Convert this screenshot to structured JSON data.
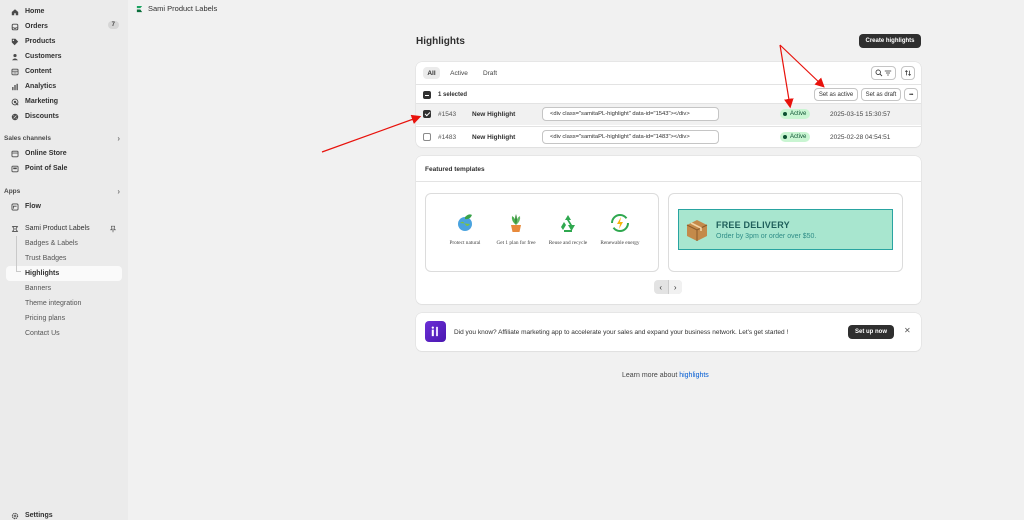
{
  "app_title": "Sami Product Labels",
  "sidebar": {
    "main_items": [
      {
        "label": "Home",
        "icon": "home-icon"
      },
      {
        "label": "Orders",
        "icon": "orders-icon",
        "badge": "7"
      },
      {
        "label": "Products",
        "icon": "tag-icon"
      },
      {
        "label": "Customers",
        "icon": "person-icon"
      },
      {
        "label": "Content",
        "icon": "content-icon"
      },
      {
        "label": "Analytics",
        "icon": "analytics-icon"
      },
      {
        "label": "Marketing",
        "icon": "target-icon"
      },
      {
        "label": "Discounts",
        "icon": "discount-icon"
      }
    ],
    "sales_channels_label": "Sales channels",
    "sales_channels": [
      {
        "label": "Online Store",
        "icon": "store-icon"
      },
      {
        "label": "Point of Sale",
        "icon": "pos-icon"
      }
    ],
    "apps_label": "Apps",
    "apps": [
      {
        "label": "Flow",
        "icon": "flow-icon"
      }
    ],
    "app_name": "Sami Product Labels",
    "app_sub_items": [
      "Badges & Labels",
      "Trust Badges",
      "Highlights",
      "Banners",
      "Theme integration",
      "Pricing plans",
      "Contact Us"
    ],
    "settings_label": "Settings"
  },
  "page": {
    "title": "Highlights",
    "create_button": "Create highlights",
    "tabs": [
      "All",
      "Active",
      "Draft"
    ],
    "selected_count": "1 selected",
    "set_active": "Set as active",
    "set_draft": "Set as draft",
    "more": "•••"
  },
  "rows": [
    {
      "id": "#1543",
      "name": "New Highlight",
      "code": "<div class=\"samitaPL-highlight\" data-id=\"1543\"></div>",
      "status": "Active",
      "date": "2025-03-15 15:30:57"
    },
    {
      "id": "#1483",
      "name": "New Highlight",
      "code": "<div class=\"samitaPL-highlight\" data-id=\"1483\"></div>",
      "status": "Active",
      "date": "2025-02-28 04:54:51"
    }
  ],
  "featured": {
    "title": "Featured templates",
    "eco_items": [
      "Protect natural",
      "Get 1 plan for free",
      "Reuse and recycle",
      "Renewable energy"
    ],
    "delivery_head": "FREE DELIVERY",
    "delivery_sub": "Order by 3pm or order over $50."
  },
  "banner": {
    "text": "Did you know? Affiliate marketing app to accelerate your sales and expand your business network. Let's get started !",
    "button": "Set up now"
  },
  "learn": {
    "prefix": "Learn more about",
    "link": "highlights"
  },
  "colors": {
    "accent_dark": "#2f2f2f",
    "active_badge_bg": "#c9f5d2",
    "active_badge_text": "#0c5132",
    "link": "#005bd3",
    "annotation_arrow": "#e8120c"
  }
}
